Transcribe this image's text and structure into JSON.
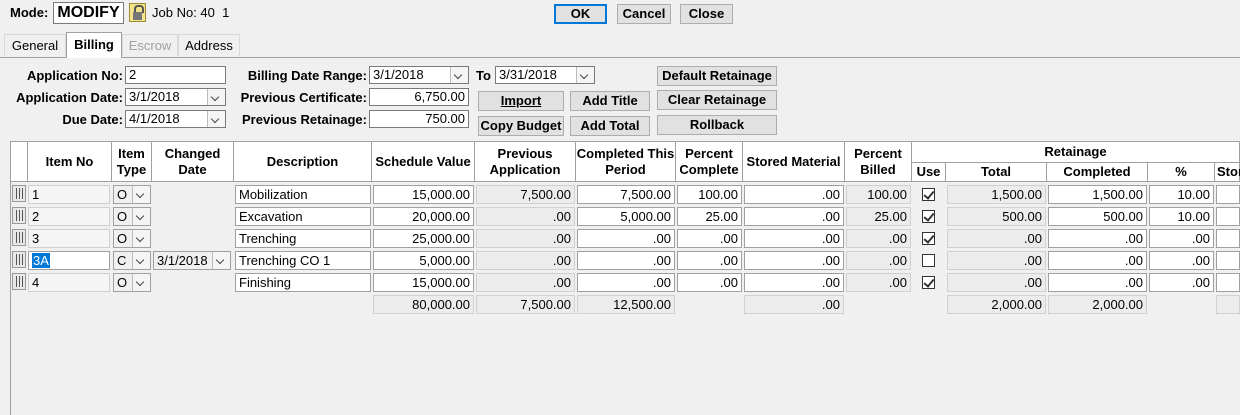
{
  "top": {
    "mode_label": "Mode:",
    "mode_value": "MODIFY",
    "job_text": "Job No: 40  1",
    "ok": "OK",
    "cancel": "Cancel",
    "close": "Close"
  },
  "tabs": [
    "General",
    "Billing",
    "Escrow",
    "Address"
  ],
  "form": {
    "app_no_label": "Application No:",
    "app_no": "2",
    "app_date_label": "Application Date:",
    "app_date": "3/1/2018",
    "due_date_label": "Due Date:",
    "due_date": "4/1/2018",
    "range_label": "Billing Date Range:",
    "range_from": "3/1/2018",
    "to_label": "To",
    "range_to": "3/31/2018",
    "prev_cert_label": "Previous Certificate:",
    "prev_cert": "6,750.00",
    "prev_ret_label": "Previous Retainage:",
    "prev_ret": "750.00"
  },
  "buttons": {
    "import": "Import",
    "add_title": "Add Title",
    "copy_budget": "Copy Budget",
    "add_total": "Add Total",
    "default_ret": "Default Retainage",
    "clear_ret": "Clear Retainage",
    "rollback": "Rollback"
  },
  "columns": {
    "item_no": "Item No",
    "item_type": "Item Type",
    "changed_date": "Changed Date",
    "description": "Description",
    "schedule_value": "Schedule Value",
    "prev_app": "Previous Application",
    "completed_period": "Completed This Period",
    "pct_complete": "Percent Complete",
    "stored_material": "Stored Material",
    "pct_billed": "Percent Billed",
    "retainage": "Retainage",
    "use": "Use",
    "total": "Total",
    "completed": "Completed",
    "pct": "%",
    "stored": "Stor"
  },
  "rows": [
    {
      "item": "1",
      "type": "O",
      "changed": "",
      "desc": "Mobilization",
      "sched": "15,000.00",
      "prev": "7,500.00",
      "comp": "7,500.00",
      "pctc": "100.00",
      "stored": ".00",
      "billed": "100.00",
      "use": true,
      "rtotal": "1,500.00",
      "rcomp": "1,500.00",
      "rpct": "10.00"
    },
    {
      "item": "2",
      "type": "O",
      "changed": "",
      "desc": "Excavation",
      "sched": "20,000.00",
      "prev": ".00",
      "comp": "5,000.00",
      "pctc": "25.00",
      "stored": ".00",
      "billed": "25.00",
      "use": true,
      "rtotal": "500.00",
      "rcomp": "500.00",
      "rpct": "10.00"
    },
    {
      "item": "3",
      "type": "O",
      "changed": "",
      "desc": "Trenching",
      "sched": "25,000.00",
      "prev": ".00",
      "comp": ".00",
      "pctc": ".00",
      "stored": ".00",
      "billed": ".00",
      "use": true,
      "rtotal": ".00",
      "rcomp": ".00",
      "rpct": ".00"
    },
    {
      "item": "3A",
      "type": "C",
      "changed": "3/1/2018",
      "desc": "Trenching CO 1",
      "sched": "5,000.00",
      "prev": ".00",
      "comp": ".00",
      "pctc": ".00",
      "stored": ".00",
      "billed": ".00",
      "use": false,
      "rtotal": ".00",
      "rcomp": ".00",
      "rpct": ".00"
    },
    {
      "item": "4",
      "type": "O",
      "changed": "",
      "desc": "Finishing",
      "sched": "15,000.00",
      "prev": ".00",
      "comp": ".00",
      "pctc": ".00",
      "stored": ".00",
      "billed": ".00",
      "use": true,
      "rtotal": ".00",
      "rcomp": ".00",
      "rpct": ".00"
    }
  ],
  "totals": {
    "sched": "80,000.00",
    "prev": "7,500.00",
    "comp": "12,500.00",
    "stored": ".00",
    "rtotal": "2,000.00",
    "rcomp": "2,000.00"
  }
}
